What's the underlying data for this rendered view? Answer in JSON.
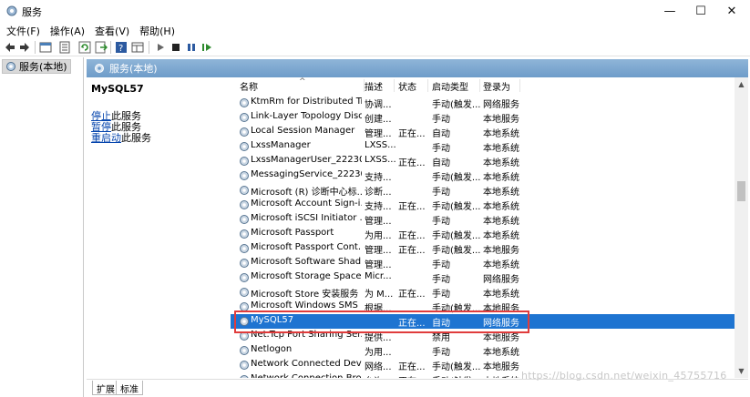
{
  "window": {
    "title": "服务",
    "controls": {
      "minimize": "—",
      "maximize": "☐",
      "close": "✕"
    }
  },
  "menu": [
    "文件(F)",
    "操作(A)",
    "查看(V)",
    "帮助(H)"
  ],
  "toolbar": {
    "icons": [
      "back-icon",
      "forward-icon",
      "console-tree-icon",
      "properties-icon",
      "refresh-icon",
      "export-icon",
      "help-icon",
      "view-icon",
      "start-icon",
      "stop-icon",
      "pause-icon",
      "restart-icon"
    ]
  },
  "tree": {
    "root_label": "服务(本地)"
  },
  "pane": {
    "header": "服务(本地)"
  },
  "description": {
    "service_name": "MySQL57",
    "stop_link": "停止",
    "stop_suffix": "此服务",
    "pause_link": "暂停",
    "pause_suffix": "此服务",
    "restart_link": "重启动",
    "restart_suffix": "此服务"
  },
  "columns": [
    "名称",
    "描述",
    "状态",
    "启动类型",
    "登录为"
  ],
  "services": [
    {
      "name": "KtmRm for Distributed Tr...",
      "desc": "协调...",
      "status": "",
      "startup": "手动(触发...",
      "logon": "网络服务"
    },
    {
      "name": "Link-Layer Topology Disc...",
      "desc": "创建...",
      "status": "",
      "startup": "手动",
      "logon": "本地服务"
    },
    {
      "name": "Local Session Manager",
      "desc": "管理...",
      "status": "正在...",
      "startup": "自动",
      "logon": "本地系统"
    },
    {
      "name": "LxssManager",
      "desc": "LXSS...",
      "status": "",
      "startup": "手动",
      "logon": "本地系统"
    },
    {
      "name": "LxssManagerUser_22230...",
      "desc": "LXSS...",
      "status": "正在...",
      "startup": "自动",
      "logon": "本地系统"
    },
    {
      "name": "MessagingService_22230...",
      "desc": "支持...",
      "status": "",
      "startup": "手动(触发...",
      "logon": "本地系统"
    },
    {
      "name": "Microsoft (R) 诊断中心标...",
      "desc": "诊断...",
      "status": "",
      "startup": "手动",
      "logon": "本地系统"
    },
    {
      "name": "Microsoft Account Sign-i...",
      "desc": "支持...",
      "status": "正在...",
      "startup": "手动(触发...",
      "logon": "本地系统"
    },
    {
      "name": "Microsoft iSCSI Initiator ...",
      "desc": "管理...",
      "status": "",
      "startup": "手动",
      "logon": "本地系统"
    },
    {
      "name": "Microsoft Passport",
      "desc": "为用...",
      "status": "正在...",
      "startup": "手动(触发...",
      "logon": "本地系统"
    },
    {
      "name": "Microsoft Passport Cont...",
      "desc": "管理...",
      "status": "正在...",
      "startup": "手动(触发...",
      "logon": "本地服务"
    },
    {
      "name": "Microsoft Software Shad...",
      "desc": "管理...",
      "status": "",
      "startup": "手动",
      "logon": "本地系统"
    },
    {
      "name": "Microsoft Storage Space...",
      "desc": "Micr...",
      "status": "",
      "startup": "手动",
      "logon": "网络服务"
    },
    {
      "name": "Microsoft Store 安装服务",
      "desc": "为 M...",
      "status": "正在...",
      "startup": "手动",
      "logon": "本地系统"
    },
    {
      "name": "Microsoft Windows SMS ...",
      "desc": "根据...",
      "status": "",
      "startup": "手动(触发...",
      "logon": "本地服务"
    },
    {
      "name": "MySQL57",
      "desc": "",
      "status": "正在...",
      "startup": "自动",
      "logon": "网络服务",
      "selected": true
    },
    {
      "name": "Net.Tcp Port Sharing Ser...",
      "desc": "提供...",
      "status": "",
      "startup": "禁用",
      "logon": "本地服务"
    },
    {
      "name": "Netlogon",
      "desc": "为用...",
      "status": "",
      "startup": "手动",
      "logon": "本地系统"
    },
    {
      "name": "Network Connected Devi...",
      "desc": "网络...",
      "status": "正在...",
      "startup": "手动(触发...",
      "logon": "本地服务"
    },
    {
      "name": "Network Connection Bro...",
      "desc": "允许...",
      "status": "正在...",
      "startup": "手动(触发...",
      "logon": "本地系统"
    }
  ],
  "tabs": [
    "扩展",
    "标准"
  ],
  "watermark": "https://blog.csdn.net/weixin_45755716"
}
